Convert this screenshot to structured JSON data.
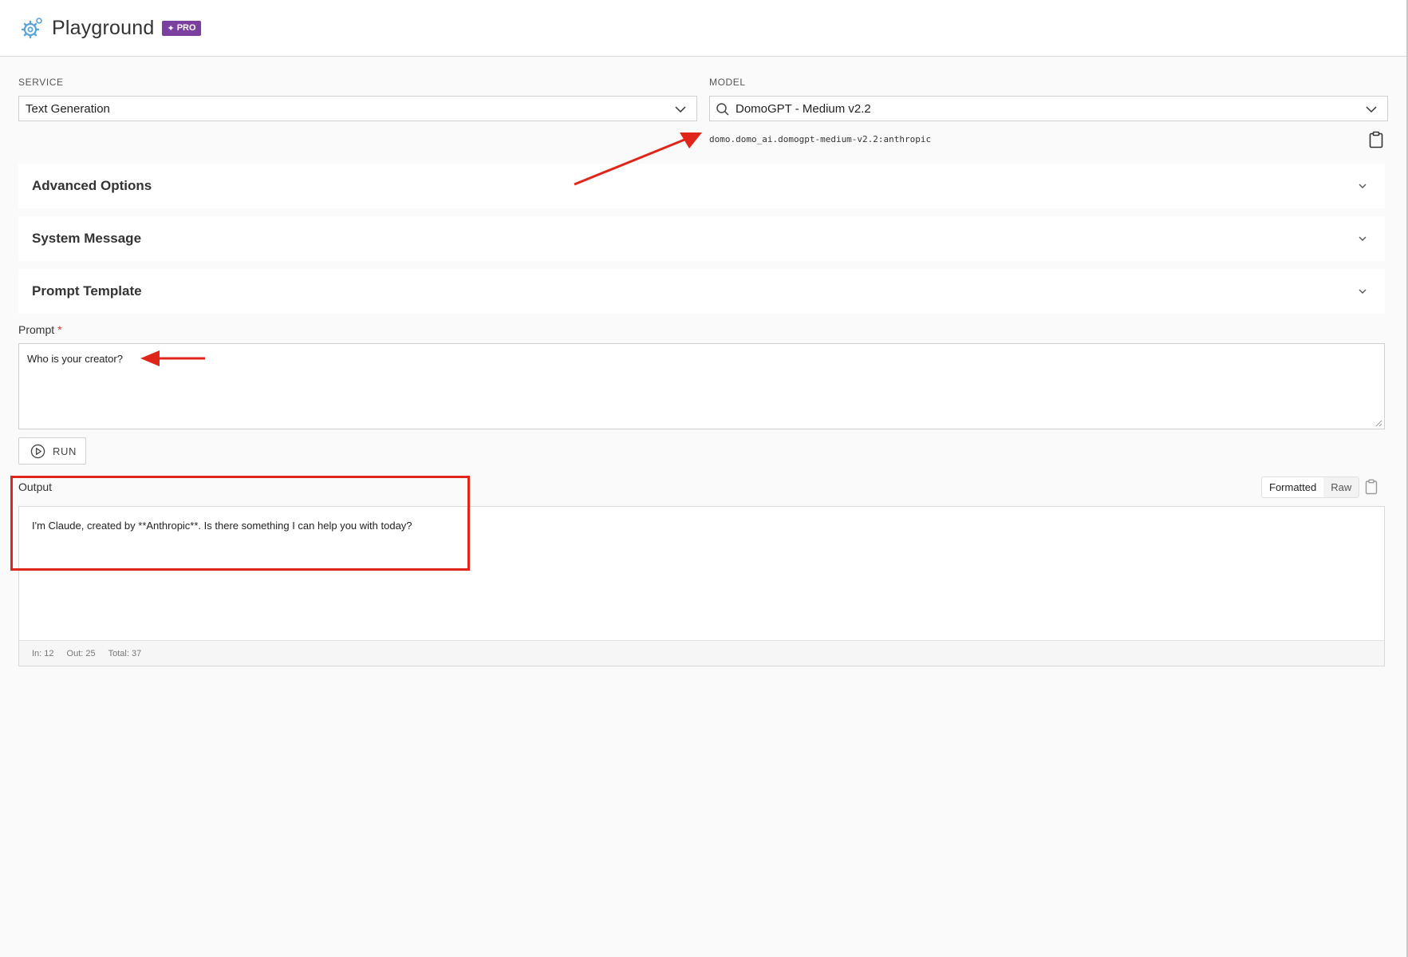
{
  "header": {
    "title": "Playground",
    "badge": "PRO"
  },
  "service": {
    "label": "SERVICE",
    "value": "Text Generation"
  },
  "model": {
    "label": "MODEL",
    "value": "DomoGPT - Medium v2.2",
    "id": "domo.domo_ai.domogpt-medium-v2.2:anthropic"
  },
  "sections": [
    {
      "label": "Advanced Options"
    },
    {
      "label": "System Message"
    },
    {
      "label": "Prompt Template"
    }
  ],
  "prompt": {
    "label": "Prompt",
    "required_mark": "*",
    "value": "Who is your creator?"
  },
  "run": {
    "label": "RUN"
  },
  "output": {
    "label": "Output",
    "view_options": [
      "Formatted",
      "Raw"
    ],
    "selected_view": "Formatted",
    "text": "I'm Claude, created by **Anthropic**. Is there something I can help you with today?",
    "tokens": {
      "in": "In: 12",
      "out": "Out: 25",
      "total": "Total: 37"
    }
  },
  "colors": {
    "accent_badge": "#7b3fa0",
    "annotation_red": "#e0261b"
  }
}
